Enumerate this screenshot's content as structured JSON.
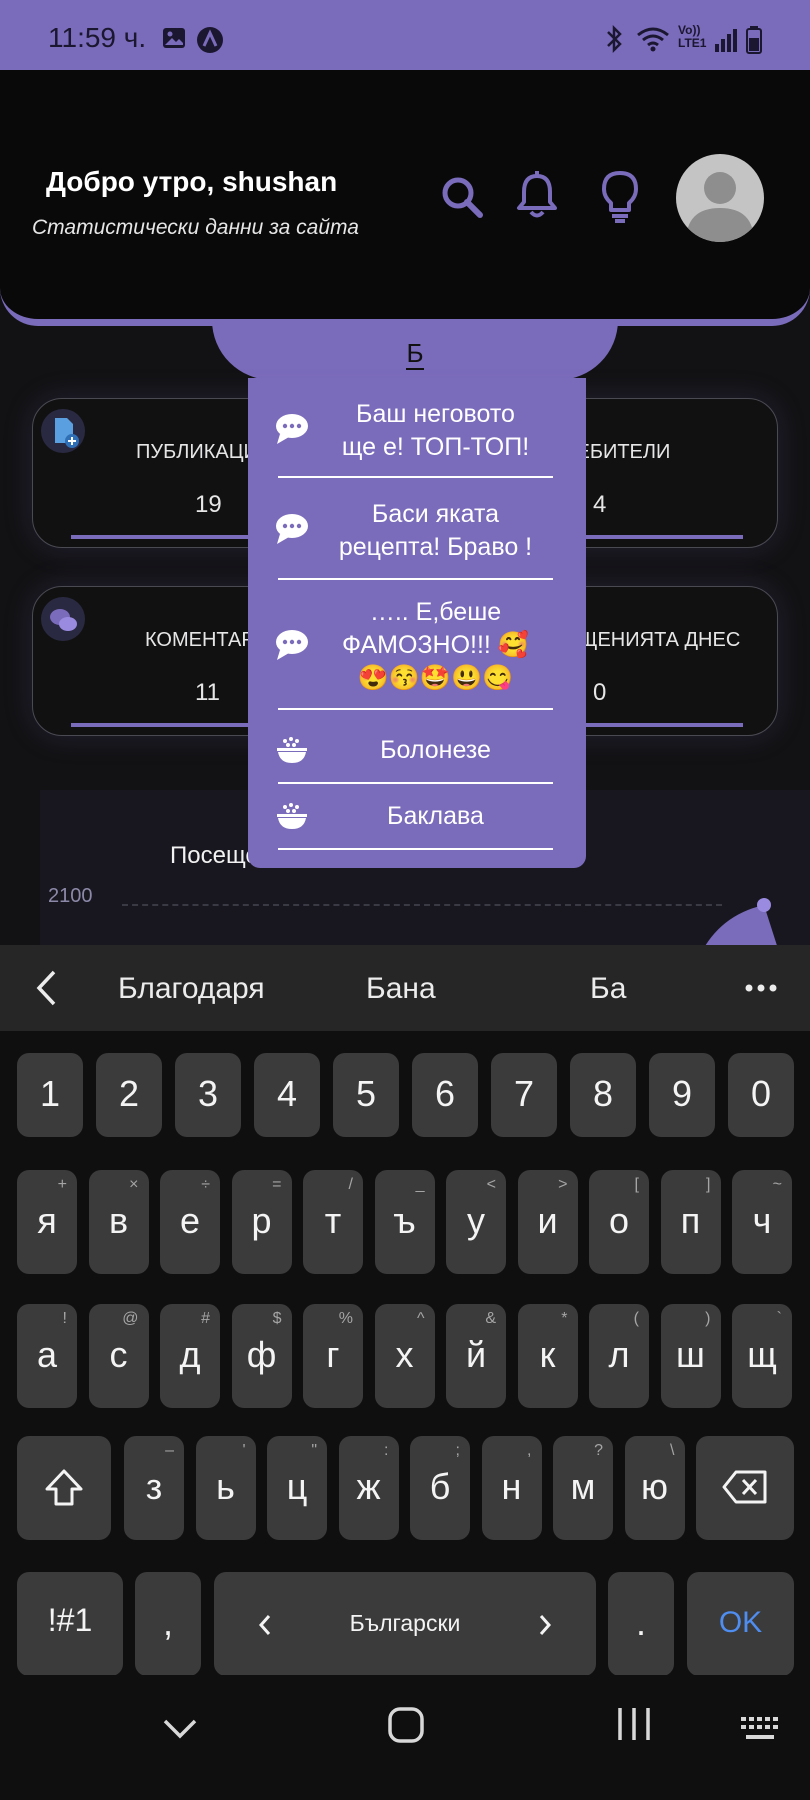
{
  "status_bar": {
    "time": "11:59 ч.",
    "network_label": "Vo)) LTE1"
  },
  "header": {
    "greeting": "Добро утро, shushan",
    "subtitle": "Статистически данни за сайта"
  },
  "search": {
    "value": "Б"
  },
  "stats": [
    {
      "label": "ПУБЛИКАЦИИ",
      "value": "19",
      "icon": "document-add-icon"
    },
    {
      "label": "ПОТРЕБИТЕЛИ",
      "value": "4",
      "icon": ""
    },
    {
      "label": "КОМЕНТАРИ",
      "value": "11",
      "icon": "chat-icon"
    },
    {
      "label": "ПОСЕЩЕНИЯТА ДНЕС",
      "value": "0",
      "icon": ""
    }
  ],
  "chart": {
    "title": "Посещения за последните 6 месеца",
    "ytick_top": "2100"
  },
  "dropdown": {
    "items": [
      {
        "type": "comment",
        "icon": "comment-icon",
        "line1": "Баш неговото",
        "line2": "ще е! ТОП-ТОП!",
        "line3": ""
      },
      {
        "type": "comment",
        "icon": "comment-icon",
        "line1": "Баси яката",
        "line2": "рецепта! Браво !",
        "line3": ""
      },
      {
        "type": "comment",
        "icon": "comment-icon",
        "line1": "….. Е,беше",
        "line2": "ФАМОЗНО!!! 🥰",
        "line3": "😍😚🤩😃😋"
      },
      {
        "type": "recipe",
        "icon": "bowl-icon",
        "line1": "Болонезе",
        "line2": "",
        "line3": ""
      },
      {
        "type": "recipe",
        "icon": "bowl-icon",
        "line1": "Баклава",
        "line2": "",
        "line3": ""
      }
    ]
  },
  "keyboard": {
    "suggestions": [
      "Благодаря",
      "Бана",
      "Ба"
    ],
    "row_numbers": [
      "1",
      "2",
      "3",
      "4",
      "5",
      "6",
      "7",
      "8",
      "9",
      "0"
    ],
    "row1": [
      {
        "k": "я",
        "s": "+"
      },
      {
        "k": "в",
        "s": "×"
      },
      {
        "k": "е",
        "s": "÷"
      },
      {
        "k": "р",
        "s": "="
      },
      {
        "k": "т",
        "s": "/"
      },
      {
        "k": "ъ",
        "s": "_"
      },
      {
        "k": "у",
        "s": "<"
      },
      {
        "k": "и",
        "s": ">"
      },
      {
        "k": "о",
        "s": "["
      },
      {
        "k": "п",
        "s": "]"
      },
      {
        "k": "ч",
        "s": "~"
      }
    ],
    "row2": [
      {
        "k": "а",
        "s": "!"
      },
      {
        "k": "с",
        "s": "@"
      },
      {
        "k": "д",
        "s": "#"
      },
      {
        "k": "ф",
        "s": "$"
      },
      {
        "k": "г",
        "s": "%"
      },
      {
        "k": "х",
        "s": "^"
      },
      {
        "k": "й",
        "s": "&"
      },
      {
        "k": "к",
        "s": "*"
      },
      {
        "k": "л",
        "s": "("
      },
      {
        "k": "ш",
        "s": ")"
      },
      {
        "k": "щ",
        "s": "`"
      }
    ],
    "row3": [
      {
        "k": "з",
        "s": "–"
      },
      {
        "k": "ь",
        "s": "'"
      },
      {
        "k": "ц",
        "s": "\""
      },
      {
        "k": "ж",
        "s": ":"
      },
      {
        "k": "б",
        "s": ";"
      },
      {
        "k": "н",
        "s": ","
      },
      {
        "k": "м",
        "s": "?"
      },
      {
        "k": "ю",
        "s": "\\"
      }
    ],
    "symbols_key": "!#1",
    "comma_key": ",",
    "space_label": "Български",
    "period_key": ".",
    "ok_key": "OK"
  },
  "colors": {
    "accent": "#7b6bbb",
    "background": "#121214",
    "key": "#3b3b3b",
    "ok_blue": "#4f8df0"
  }
}
